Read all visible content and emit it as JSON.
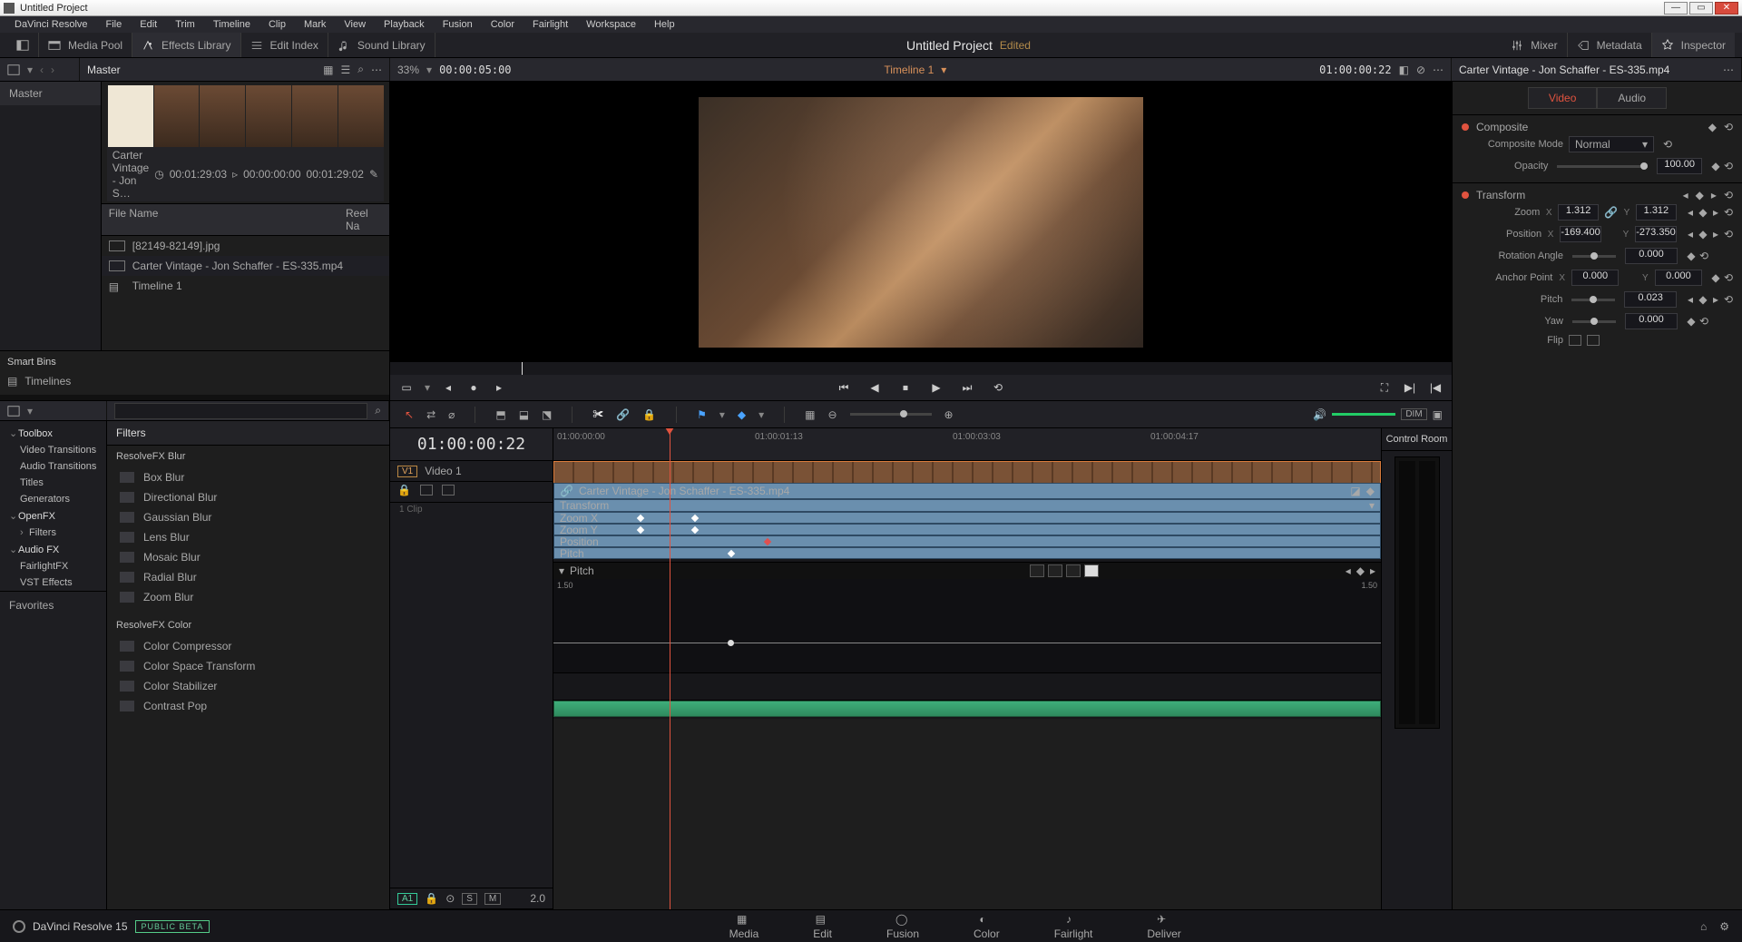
{
  "window": {
    "title": "Untitled Project"
  },
  "menus": [
    "DaVinci Resolve",
    "File",
    "Edit",
    "Trim",
    "Timeline",
    "Clip",
    "Mark",
    "View",
    "Playback",
    "Fusion",
    "Color",
    "Fairlight",
    "Workspace",
    "Help"
  ],
  "workspace": {
    "media_pool": "Media Pool",
    "fx_lib": "Effects Library",
    "edit_index": "Edit Index",
    "sound_lib": "Sound Library",
    "project": "Untitled Project",
    "edited": "Edited",
    "mixer": "Mixer",
    "metadata": "Metadata",
    "inspector": "Inspector"
  },
  "subbar": {
    "left_label": "Master",
    "zoom": "33%",
    "timecode": "00:00:05:00",
    "timeline_name": "Timeline 1",
    "viewer_tc": "01:00:00:22",
    "clip_name": "Carter Vintage - Jon Schaffer - ES-335.mp4"
  },
  "bins": {
    "root": "Master"
  },
  "clipmeta": {
    "name": "Carter Vintage - Jon S…",
    "dur": "00:01:29:03",
    "in": "00:00:00:00",
    "out": "00:01:29:02"
  },
  "file_hdr": {
    "c1": "File Name",
    "c2": "Reel Na"
  },
  "files": [
    {
      "name": "[82149-82149].jpg",
      "sel": false
    },
    {
      "name": "Carter Vintage - Jon Schaffer - ES-335.mp4",
      "sel": true
    },
    {
      "name": "Timeline 1",
      "sel": false
    }
  ],
  "smartbins": {
    "hdr": "Smart Bins",
    "items": [
      "Timelines"
    ]
  },
  "fxtree": [
    {
      "t": "Toolbox",
      "k": "expd h"
    },
    {
      "t": "Video Transitions",
      "k": "s"
    },
    {
      "t": "Audio Transitions",
      "k": "s"
    },
    {
      "t": "Titles",
      "k": "s"
    },
    {
      "t": "Generators",
      "k": "s"
    },
    {
      "t": "OpenFX",
      "k": "expd h"
    },
    {
      "t": "Filters",
      "k": "s exp"
    },
    {
      "t": "Audio FX",
      "k": "expd h"
    },
    {
      "t": "FairlightFX",
      "k": "s"
    },
    {
      "t": "VST Effects",
      "k": "s"
    }
  ],
  "filters_hdr": "Filters",
  "filters_group1": "ResolveFX Blur",
  "filters_items1": [
    "Box Blur",
    "Directional Blur",
    "Gaussian Blur",
    "Lens Blur",
    "Mosaic Blur",
    "Radial Blur",
    "Zoom Blur"
  ],
  "filters_group2": "ResolveFX Color",
  "filters_items2": [
    "Color Compressor",
    "Color Space Transform",
    "Color Stabilizer",
    "Contrast Pop"
  ],
  "favorites": "Favorites",
  "timeline": {
    "tc": "01:00:00:22",
    "ticks": [
      "01:00:00:00",
      "01:00:01:13",
      "01:00:03:03",
      "01:00:04:17"
    ],
    "v_tag": "V1",
    "v_label": "Video 1",
    "v_count": "1 Clip",
    "clip_title": "Carter Vintage - Jon Schaffer - ES-335.mp4",
    "clip_group": "Transform",
    "kf": [
      "Zoom X",
      "Zoom Y",
      "Position",
      "Pitch"
    ],
    "curve_name": "Pitch",
    "curve_lo": "1.50",
    "curve_hi": "1.50",
    "a_tag": "A1",
    "a_val": "2.0",
    "a_s": "S",
    "a_m": "M",
    "ctrlroom": "Control Room"
  },
  "inspector": {
    "tabs": {
      "video": "Video",
      "audio": "Audio"
    },
    "composite": {
      "title": "Composite",
      "mode_lbl": "Composite Mode",
      "mode_val": "Normal",
      "opacity_lbl": "Opacity",
      "opacity_val": "100.00"
    },
    "transform": {
      "title": "Transform",
      "zoom_lbl": "Zoom",
      "zoom_x": "1.312",
      "zoom_y": "1.312",
      "pos_lbl": "Position",
      "pos_x": "-169.400",
      "pos_y": "-273.350",
      "rot_lbl": "Rotation Angle",
      "rot": "0.000",
      "anchor_lbl": "Anchor Point",
      "anchor_x": "0.000",
      "anchor_y": "0.000",
      "pitch_lbl": "Pitch",
      "pitch": "0.023",
      "yaw_lbl": "Yaw",
      "yaw": "0.000",
      "flip_lbl": "Flip"
    }
  },
  "pages": {
    "brand": "DaVinci Resolve 15",
    "beta": "PUBLIC BETA",
    "tabs": [
      "Media",
      "Edit",
      "Fusion",
      "Color",
      "Fairlight",
      "Deliver"
    ],
    "active": 1
  }
}
